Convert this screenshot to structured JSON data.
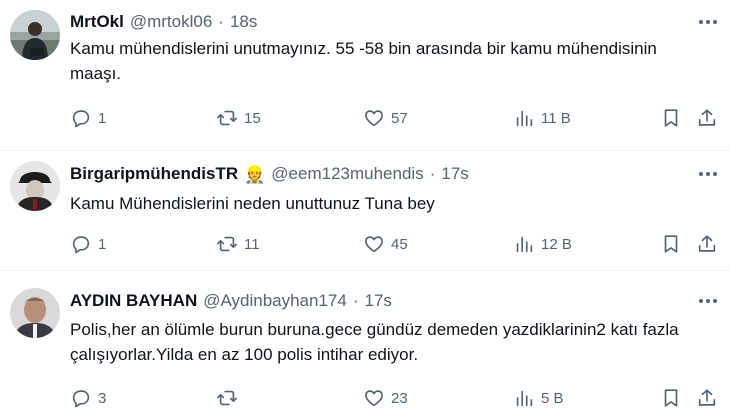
{
  "tweets": [
    {
      "name": "MrtOkl",
      "badge": "",
      "handle": "@mrtokl06",
      "time": "18s",
      "text": "Kamu mühendislerini unutmayınız. 55 -58 bin arasında bir kamu mühendisinin maaşı.",
      "replies": "1",
      "retweets": "15",
      "likes": "57",
      "views": "11 B"
    },
    {
      "name": "BirgaripmühendisTR",
      "badge": "👷",
      "handle": "@eem123muhendis",
      "time": "17s",
      "text": "Kamu Mühendislerini neden unuttunuz Tuna bey",
      "replies": "1",
      "retweets": "11",
      "likes": "45",
      "views": "12 B"
    },
    {
      "name": "AYDIN BAYHAN",
      "badge": "",
      "handle": "@Aydinbayhan174",
      "time": "17s",
      "text": "Polis,her an ölümle burun buruna.gece gündüz demeden yazdiklarinin2 katı fazla çalışıyorlar.Yilda en az 100 polis intihar ediyor.",
      "replies": "3",
      "retweets": "",
      "likes": "23",
      "views": "5 B"
    }
  ],
  "separator": "·",
  "icons": {
    "reply": "reply-icon",
    "retweet": "retweet-icon",
    "like": "heart-icon",
    "views": "views-icon",
    "bookmark": "bookmark-icon",
    "share": "share-icon",
    "more": "more-icon"
  },
  "colors": {
    "text": "#0f1419",
    "secondary": "#536471",
    "divider": "#eff3f4"
  }
}
